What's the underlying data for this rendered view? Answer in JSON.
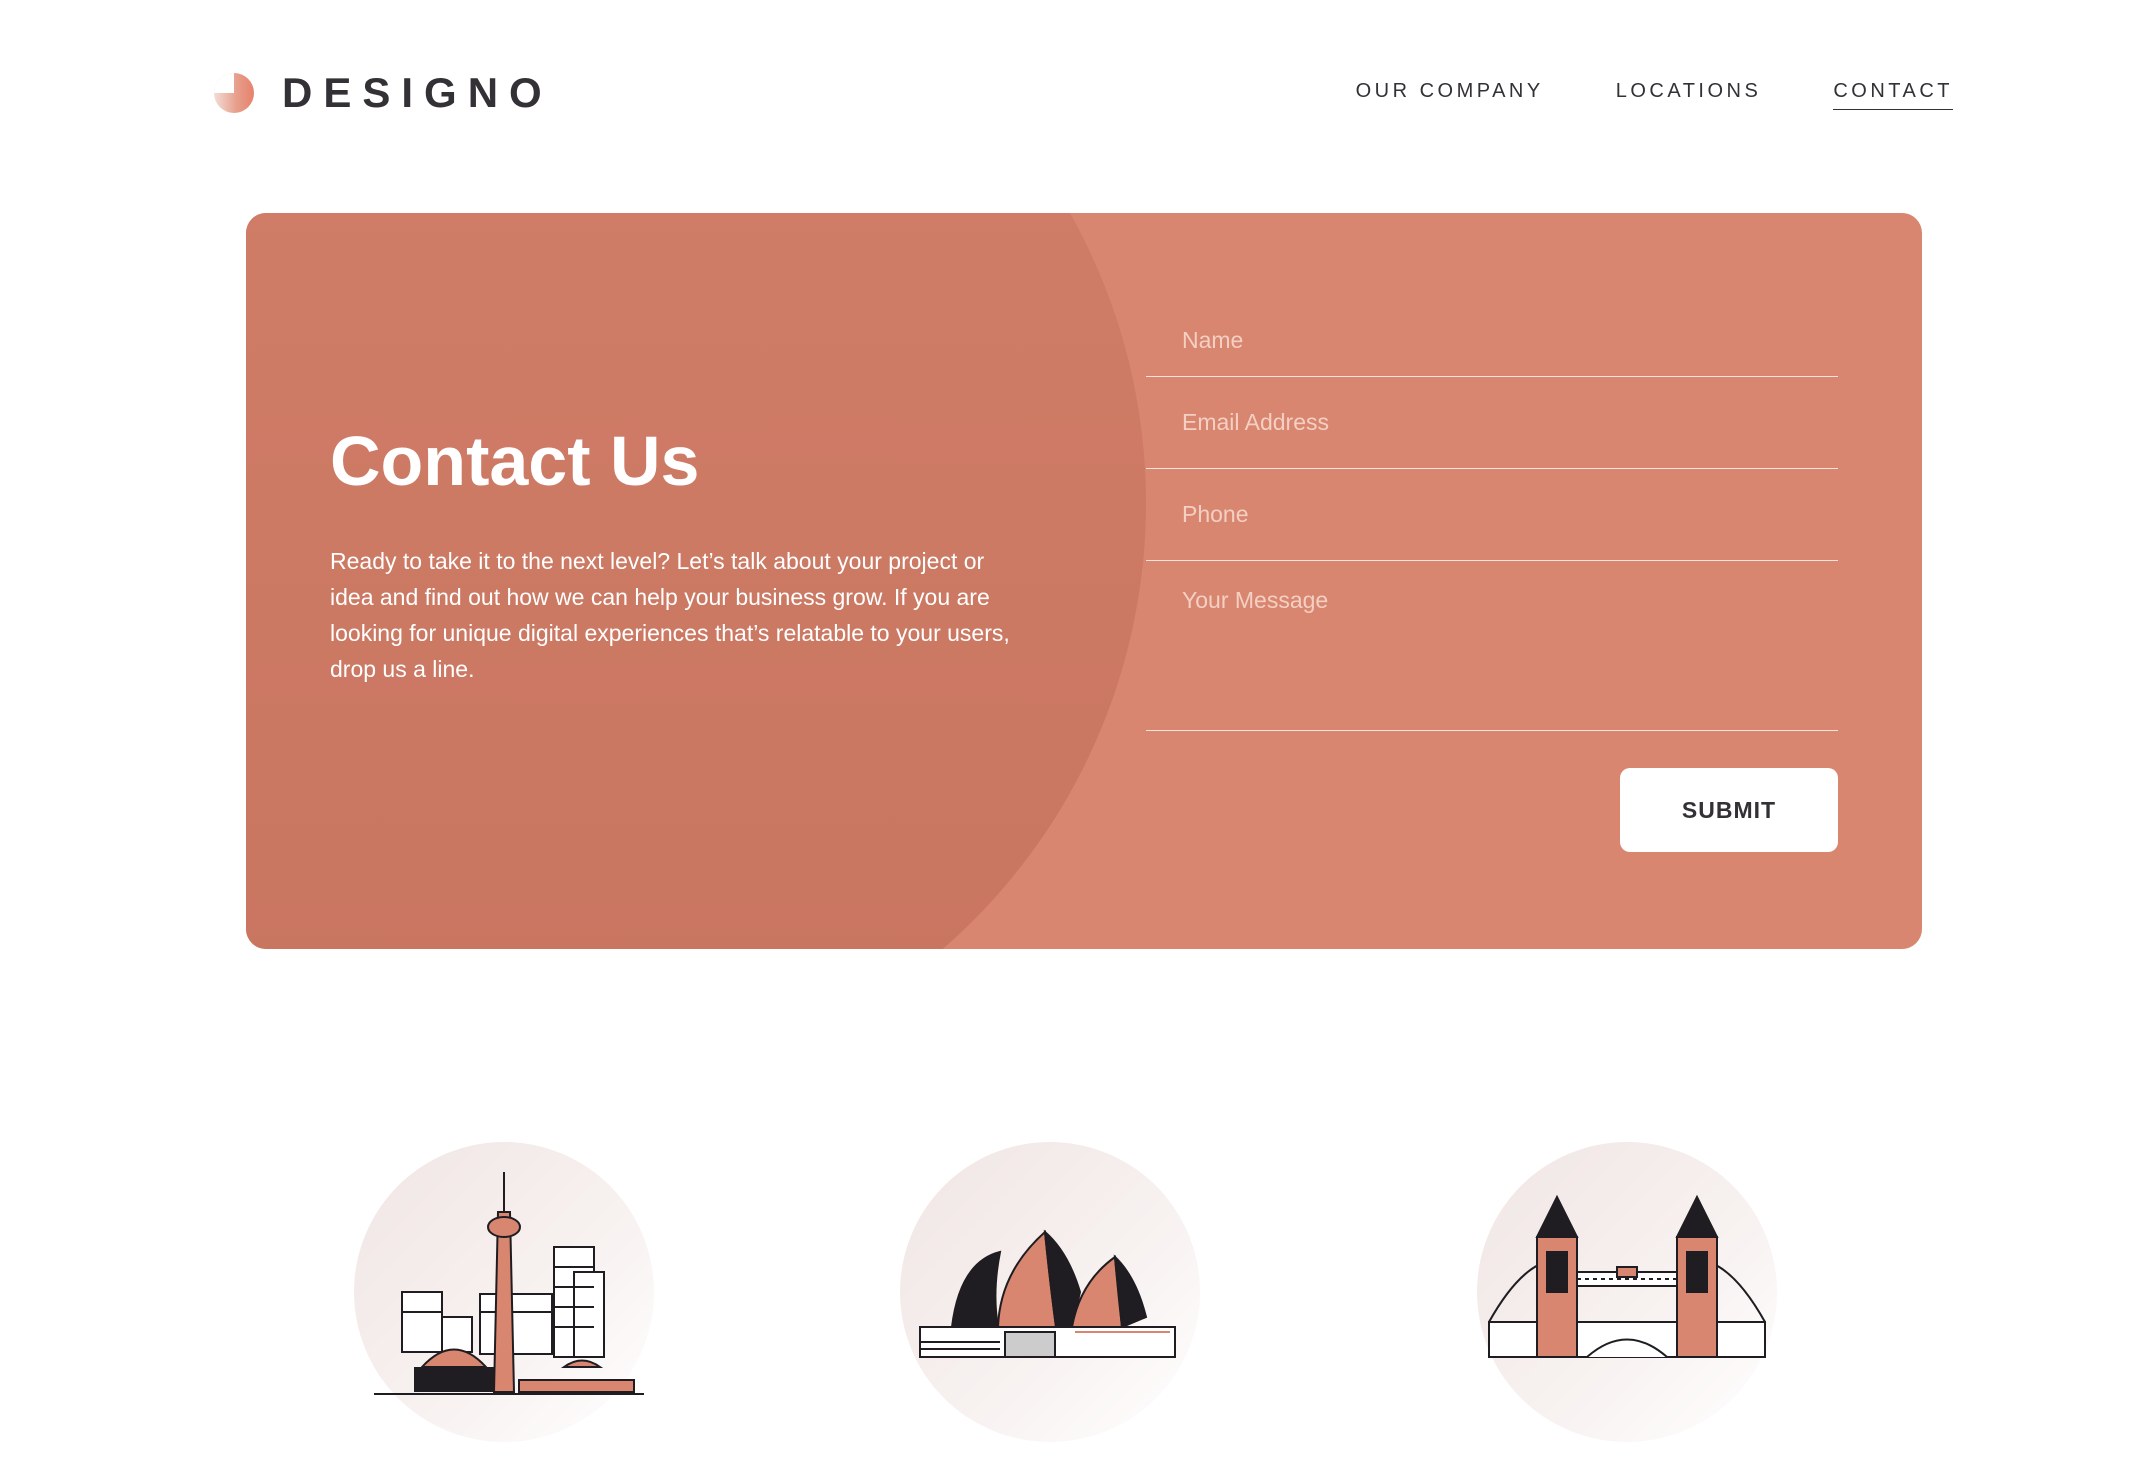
{
  "brand": {
    "name": "DESIGNO",
    "icon": "logo-circle-icon"
  },
  "nav": {
    "items": [
      {
        "label": "OUR COMPANY"
      },
      {
        "label": "LOCATIONS"
      },
      {
        "label": "CONTACT",
        "active": true
      }
    ]
  },
  "contact": {
    "title": "Contact Us",
    "description": "Ready to take it to the next level? Let’s talk about your project or idea and find out how we can help your business grow. If you are looking for unique digital experiences that’s relatable to your users, drop us a line.",
    "form": {
      "name_placeholder": "Name",
      "email_placeholder": "Email Address",
      "phone_placeholder": "Phone",
      "message_placeholder": "Your Message",
      "submit_label": "SUBMIT"
    }
  },
  "locations": [
    {
      "icon": "toronto-skyline-icon"
    },
    {
      "icon": "sydney-opera-house-icon"
    },
    {
      "icon": "tower-bridge-icon"
    }
  ],
  "colors": {
    "accent": "#d8866f",
    "accent_dark": "#c87560",
    "text_dark": "#333136",
    "white": "#ffffff"
  }
}
